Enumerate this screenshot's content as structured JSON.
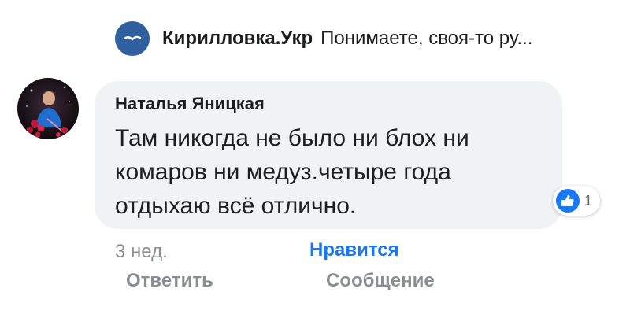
{
  "context": {
    "page_name": "Кирилловка.Укр",
    "reply_snippet": "Понимаете, своя-то ру...",
    "page_avatar_icon": "seagull-icon",
    "page_avatar_color": "#2f5f9e"
  },
  "comment": {
    "author": "Наталья Яницкая",
    "lines": [
      "Там никогда не было ни блох ни",
      "комаров ни медуз.четыре года",
      "отдыхаю всё отлично."
    ],
    "avatar_icon": "user-photo-avatar",
    "bubble_color": "#f0f2f5"
  },
  "reaction": {
    "icon": "thumbs-up-icon",
    "count": "1",
    "color": "#1877f2"
  },
  "actions": {
    "time": "3 нед.",
    "like": "Нравится",
    "reply": "Ответить",
    "message": "Сообщение"
  }
}
